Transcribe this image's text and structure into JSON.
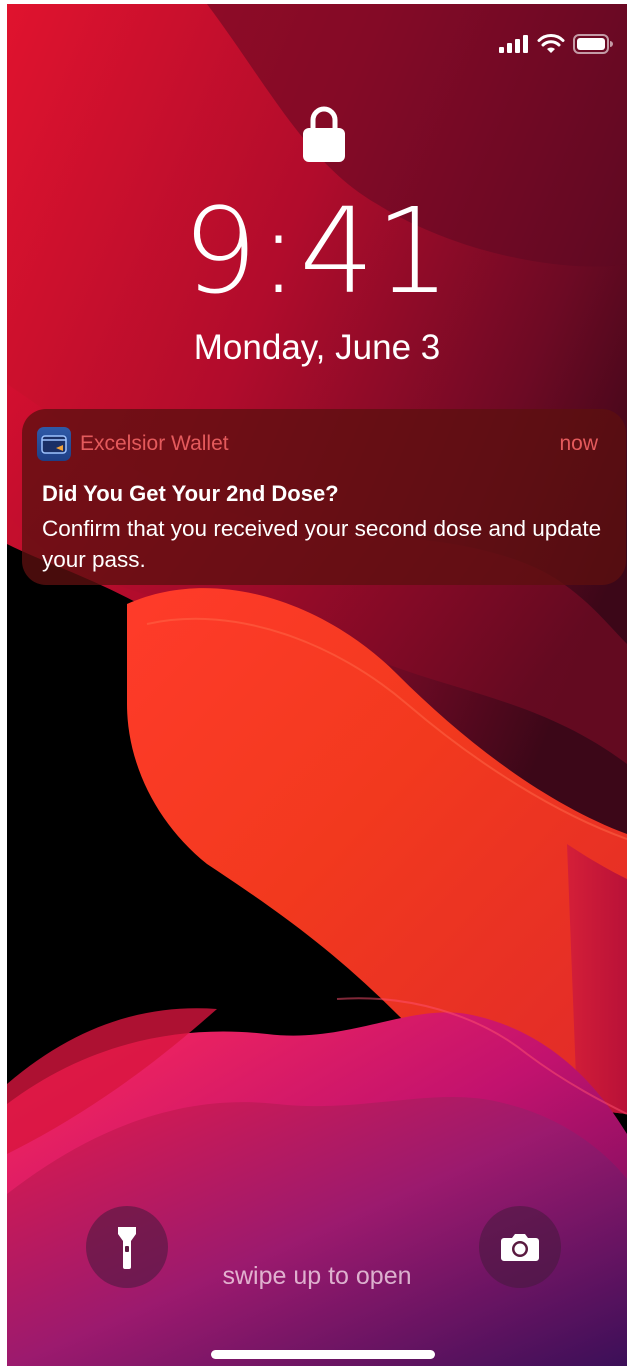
{
  "status_bar": {
    "cellular_icon": "cellular-signal-icon",
    "wifi_icon": "wifi-icon",
    "battery_icon": "battery-icon"
  },
  "lock_screen": {
    "lock_icon": "padlock-icon",
    "time": "9:41",
    "date": "Monday, June 3"
  },
  "notification": {
    "app_icon": "wallet-app-icon",
    "app_name": "Excelsior Wallet",
    "time": "now",
    "title": "Did You Get Your 2nd Dose?",
    "body": "Confirm that you received your second dose and update your pass.",
    "accent_color": "#e45a5c"
  },
  "bottom_controls": {
    "flashlight_icon": "flashlight-icon",
    "camera_icon": "camera-icon",
    "swipe_hint": "swipe up to open"
  },
  "colors": {
    "wallpaper_red": "#c8102e",
    "wallpaper_orange": "#ff4a1c",
    "wallpaper_magenta": "#b5127a",
    "notification_bg": "#5c1010"
  }
}
